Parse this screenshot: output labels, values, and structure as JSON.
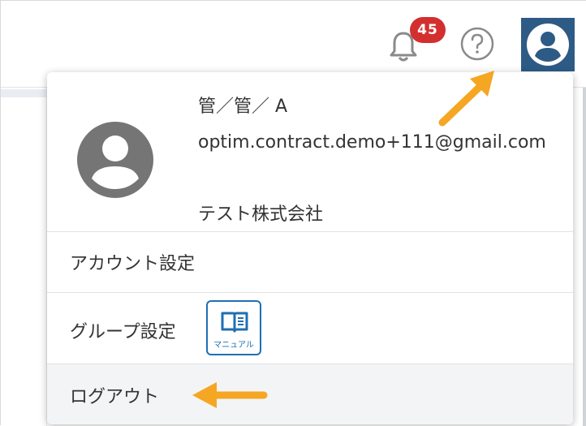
{
  "header": {
    "notification_count": "45",
    "help_icon": "question-circle-icon",
    "bell_icon": "bell-icon",
    "avatar_icon": "account-circle-icon"
  },
  "profile": {
    "name": "管／管／ A",
    "email": "optim.contract.demo+111@gmail.com",
    "company": "テスト株式会社",
    "avatar_icon": "account-circle-icon"
  },
  "menu": {
    "account_settings": "アカウント設定",
    "group_settings": "グループ設定",
    "manual_label": "マニュアル",
    "manual_icon": "book-icon",
    "logout": "ログアウト"
  },
  "colors": {
    "accent": "#f5a623",
    "badge": "#d32f2f",
    "avatar_button": "#2d5b86",
    "manual_blue": "#1f6fb2"
  }
}
